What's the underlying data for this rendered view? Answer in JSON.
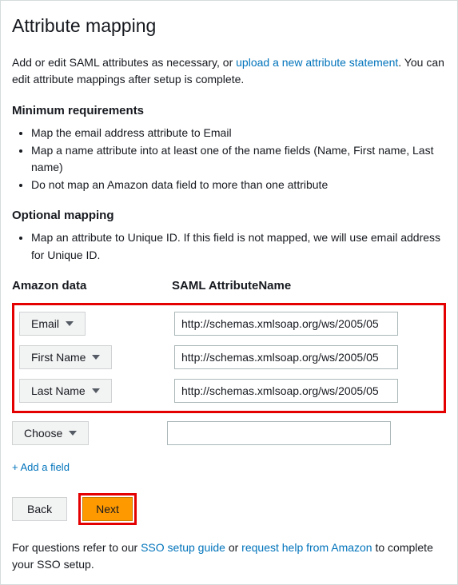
{
  "title": "Attribute mapping",
  "intro_pre": "Add or edit SAML attributes as necessary, or ",
  "intro_link": "upload a new attribute statement",
  "intro_post": ". You can edit attribute mappings after setup is complete.",
  "min_req_title": "Minimum requirements",
  "min_req_items": [
    "Map the email address attribute to Email",
    "Map a name attribute into at least one of the name fields (Name, First name, Last name)",
    "Do not map an Amazon data field to more than one attribute"
  ],
  "opt_map_title": "Optional mapping",
  "opt_map_items": [
    "Map an attribute to Unique ID. If this field is not mapped, we will use email address for Unique ID."
  ],
  "col_amazon": "Amazon data",
  "col_saml": "SAML AttributeName",
  "rows": [
    {
      "amazon": "Email",
      "saml": "http://schemas.xmlsoap.org/ws/2005/05"
    },
    {
      "amazon": "First Name",
      "saml": "http://schemas.xmlsoap.org/ws/2005/05"
    },
    {
      "amazon": "Last Name",
      "saml": "http://schemas.xmlsoap.org/ws/2005/05"
    }
  ],
  "extra_row": {
    "amazon": "Choose",
    "saml": ""
  },
  "add_field_label": "+ Add a field",
  "back_label": "Back",
  "next_label": "Next",
  "footer_pre": "For questions refer to our ",
  "footer_link1": "SSO setup guide",
  "footer_mid": " or ",
  "footer_link2": "request help from Amazon",
  "footer_post": " to complete your SSO setup."
}
